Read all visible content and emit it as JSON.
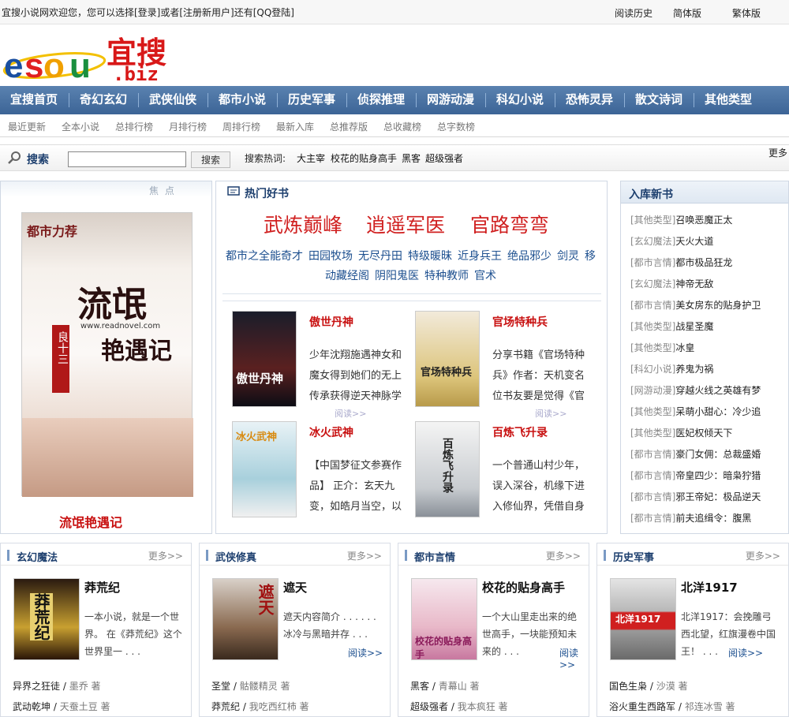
{
  "topbar": {
    "welcome": "宜搜小说网欢迎您，您可以选择[登录]或者[注册新用户]还有[QQ登陆]",
    "links": [
      "阅读历史",
      "简体版",
      "繁体版"
    ]
  },
  "logo": {
    "brand": "eSou",
    "cn": "宜搜",
    "domain": ".biz",
    "colors": {
      "e": "#1a4fa0",
      "s": "#e02020",
      "o": "#f0a000",
      "u": "#1a8f3f",
      "cn": "#d81818"
    }
  },
  "nav": [
    "宜搜首页",
    "奇幻玄幻",
    "武侠仙侠",
    "都市小说",
    "历史军事",
    "侦探推理",
    "网游动漫",
    "科幻小说",
    "恐怖灵异",
    "散文诗词",
    "其他类型"
  ],
  "subnav": [
    "最近更新",
    "全本小说",
    "总排行榜",
    "月排行榜",
    "周排行榜",
    "最新入库",
    "总推荐版",
    "总收藏榜",
    "总字数榜"
  ],
  "search": {
    "label": "搜索",
    "button": "搜索",
    "hot_label": "搜索热词:",
    "hot": [
      "大主宰",
      "校花的贴身高手",
      "黑客",
      "超级强者"
    ],
    "more": "更多"
  },
  "feature": {
    "header": "焦 点",
    "title": "流氓艳遇记",
    "cover_top": "都市力荐",
    "cover_main": "流氓",
    "cover_main2": "艳遇记",
    "cover_author": "良十三",
    "cover_url": "www.readnovel.com"
  },
  "hot": {
    "header": "热门好书",
    "big": [
      "武炼巅峰",
      "逍遥军医",
      "官路弯弯"
    ],
    "links_row1": [
      "都市之全能奇才",
      "田园牧场",
      "无尽丹田",
      "特级暖昧",
      "近身兵王",
      "绝品邪少",
      "剑灵",
      "移"
    ],
    "links_row2": [
      "动藏经阁",
      "阴阳鬼医",
      "特种教师",
      "官术"
    ],
    "books": [
      {
        "title": "傲世丹神",
        "desc": "少年沈翔施遇神女和魔女得到她们的无上传承获得逆天神脉学得绝世",
        "more": "阅读>>",
        "cover_text": "傲世丹神"
      },
      {
        "title": "官场特种兵",
        "desc": "分享书籍《官场特种兵》作者：天机变名位书友要是觉得《官场特种兵",
        "more": "阅读>>",
        "cover_text": "官场特种兵"
      },
      {
        "title": "冰火武神",
        "desc": "【中国梦征文参赛作品】 正介：玄天九变，如皓月当空，以天地",
        "more": "阅读>>",
        "cover_text": "冰火武神"
      },
      {
        "title": "百炼飞升录",
        "desc": "一个普通山村少年，误入深谷，机缘下进入修仙界，凭借自身的努力",
        "more": "阅读>>",
        "cover_text": "百炼飞升录"
      }
    ]
  },
  "newbooks": {
    "header": "入库新书",
    "items": [
      {
        "cat": "[其他类型]",
        "title": "召唤恶魔正太"
      },
      {
        "cat": "[玄幻魔法]",
        "title": "天火大道"
      },
      {
        "cat": "[都市言情]",
        "title": "都市极品狂龙"
      },
      {
        "cat": "[玄幻魔法]",
        "title": "神帝无敌"
      },
      {
        "cat": "[都市言情]",
        "title": "美女房东的贴身护卫"
      },
      {
        "cat": "[其他类型]",
        "title": "战星圣魔"
      },
      {
        "cat": "[其他类型]",
        "title": "冰皇"
      },
      {
        "cat": "[科幻小说]",
        "title": "养鬼为祸"
      },
      {
        "cat": "[网游动漫]",
        "title": "穿越火线之英雄有梦"
      },
      {
        "cat": "[其他类型]",
        "title": "呆萌小甜心：冷少追"
      },
      {
        "cat": "[其他类型]",
        "title": "医妃权倾天下"
      },
      {
        "cat": "[都市言情]",
        "title": "豪门女佣：总裁盛婚"
      },
      {
        "cat": "[都市言情]",
        "title": "帝皇四少：暗枭狞猎"
      },
      {
        "cat": "[都市言情]",
        "title": "邪王帝妃：极品逆天"
      },
      {
        "cat": "[都市言情]",
        "title": "前夫追缉令：腹黑"
      }
    ]
  },
  "categories": [
    {
      "name": "玄幻魔法",
      "more": "更多>>",
      "title": "莽荒纪",
      "desc": "一本小说，就是一个世界。 在《莽荒纪》这个世界里一 . . .",
      "read": "",
      "cover_text": "莽荒纪",
      "rows": [
        {
          "t": "异界之狂徒",
          "a": "墨乔 著"
        },
        {
          "t": "武动乾坤",
          "a": "天蚕土豆 著"
        }
      ]
    },
    {
      "name": "武侠修真",
      "more": "更多>>",
      "title": "遮天",
      "desc": "遮天内容简介 . . . . . .            冰冷与黑暗并存 . . .",
      "read": "阅读>>",
      "cover_text": "遮天",
      "rows": [
        {
          "t": "圣堂",
          "a": "骷髅精灵 著"
        },
        {
          "t": "莽荒纪",
          "a": "我吃西红柿 著"
        }
      ]
    },
    {
      "name": "都市言情",
      "more": "更多>>",
      "title": "校花的贴身高手",
      "desc": "一个大山里走出来的绝世高手，一块能预知未来的 . . .",
      "read": "阅读>>",
      "cover_text": "校花的贴身高手",
      "rows": [
        {
          "t": "黑客",
          "a": "青幕山 著"
        },
        {
          "t": "超级强者",
          "a": "我本疯狂 著"
        }
      ]
    },
    {
      "name": "历史军事",
      "more": "更多>>",
      "title": "北洋1917",
      "desc": "北洋1917：会挽雕弓西北望，红旗漫卷中国王！ . . .",
      "read": "阅读>>",
      "cover_text": "北洋1917",
      "rows": [
        {
          "t": "国色生枭",
          "a": "沙漠 著"
        },
        {
          "t": "浴火重生西路军",
          "a": "祁连冰雪 著"
        }
      ]
    }
  ]
}
